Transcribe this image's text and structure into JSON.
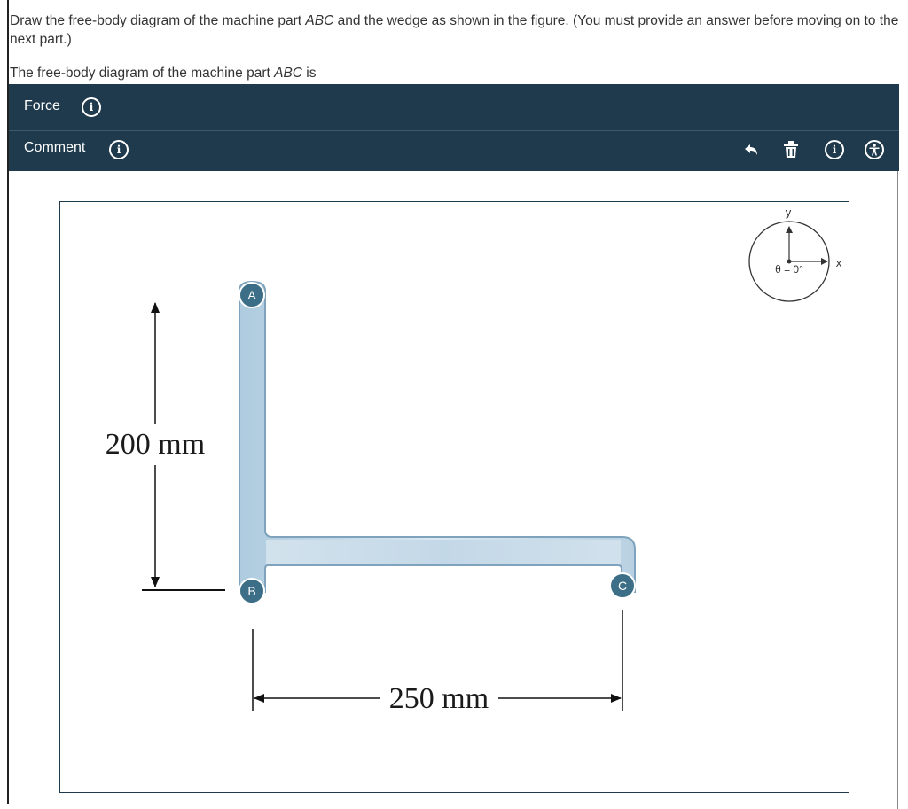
{
  "question": {
    "part1": "Draw the free-body diagram of the machine part ",
    "part1_italic": "ABC",
    "part2": " and the wedge as shown in the figure. (You must provide an answer before moving on to the next part.)"
  },
  "subprompt": {
    "part1": "The free-body diagram of the machine part ",
    "italic": "ABC",
    "part2": " is"
  },
  "toolbar": {
    "force_label": "Force",
    "comment_label": "Comment",
    "info_glyph": "i",
    "icons": [
      "undo-icon",
      "trash-icon",
      "info-icon",
      "accessibility-icon"
    ],
    "background": "#1e3a4c"
  },
  "diagram": {
    "point_a": "A",
    "point_b": "B",
    "point_c": "C",
    "vertical_dimension": "200 mm",
    "horizontal_dimension": "250 mm",
    "axis_x": "x",
    "axis_y": "y",
    "angle_readout": "θ = 0°",
    "point_color": "#3d6e87"
  }
}
